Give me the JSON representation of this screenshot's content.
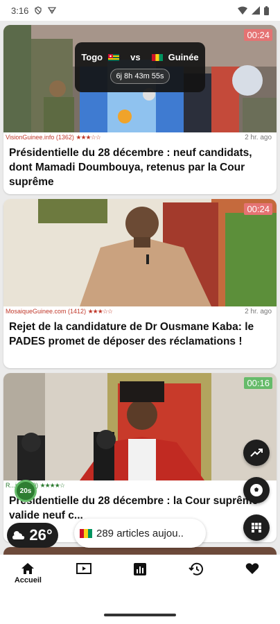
{
  "status_bar": {
    "time": "3:16",
    "icons": [
      "shield-icon",
      "notification-icon",
      "wifi-icon",
      "signal-icon",
      "battery-icon"
    ]
  },
  "match": {
    "team_home": "Togo",
    "versus": "vs",
    "team_away": "Guinée",
    "countdown": "6j 8h 43m 55s"
  },
  "articles": [
    {
      "timer": "00:24",
      "timer_color": "#e57373",
      "source": "VisionGuinee.info (1362)",
      "stars": "★★★☆☆",
      "age": "2 hr. ago",
      "title": "Présidentielle du 28 décembre : neuf candidats, dont Mamadi Doumbouya, retenus par la Cour suprême"
    },
    {
      "timer": "00:24",
      "timer_color": "#e57373",
      "source": "MosaiqueGuinee.com (1412)",
      "stars": "★★★☆☆",
      "age": "2 hr. ago",
      "title": "Rejet de la candidature de Dr Ousmane Kaba: le PADES promet de déposer des réclamations !"
    },
    {
      "timer": "00:16",
      "timer_color": "#66bb6a",
      "source": "R...info (30)",
      "stars": "★★★★☆",
      "age": "",
      "title": "Présidentielle du 28 décembre : la Cour suprême valide neuf c..."
    }
  ],
  "floating": {
    "green_badge": "20s",
    "weather_temp": "26°",
    "articles_count": "289 articles aujou.."
  },
  "bottom_nav": {
    "home_label": "Accueil"
  },
  "colors": {
    "accent_red": "#c0392b",
    "dark": "#1e1e1e"
  }
}
